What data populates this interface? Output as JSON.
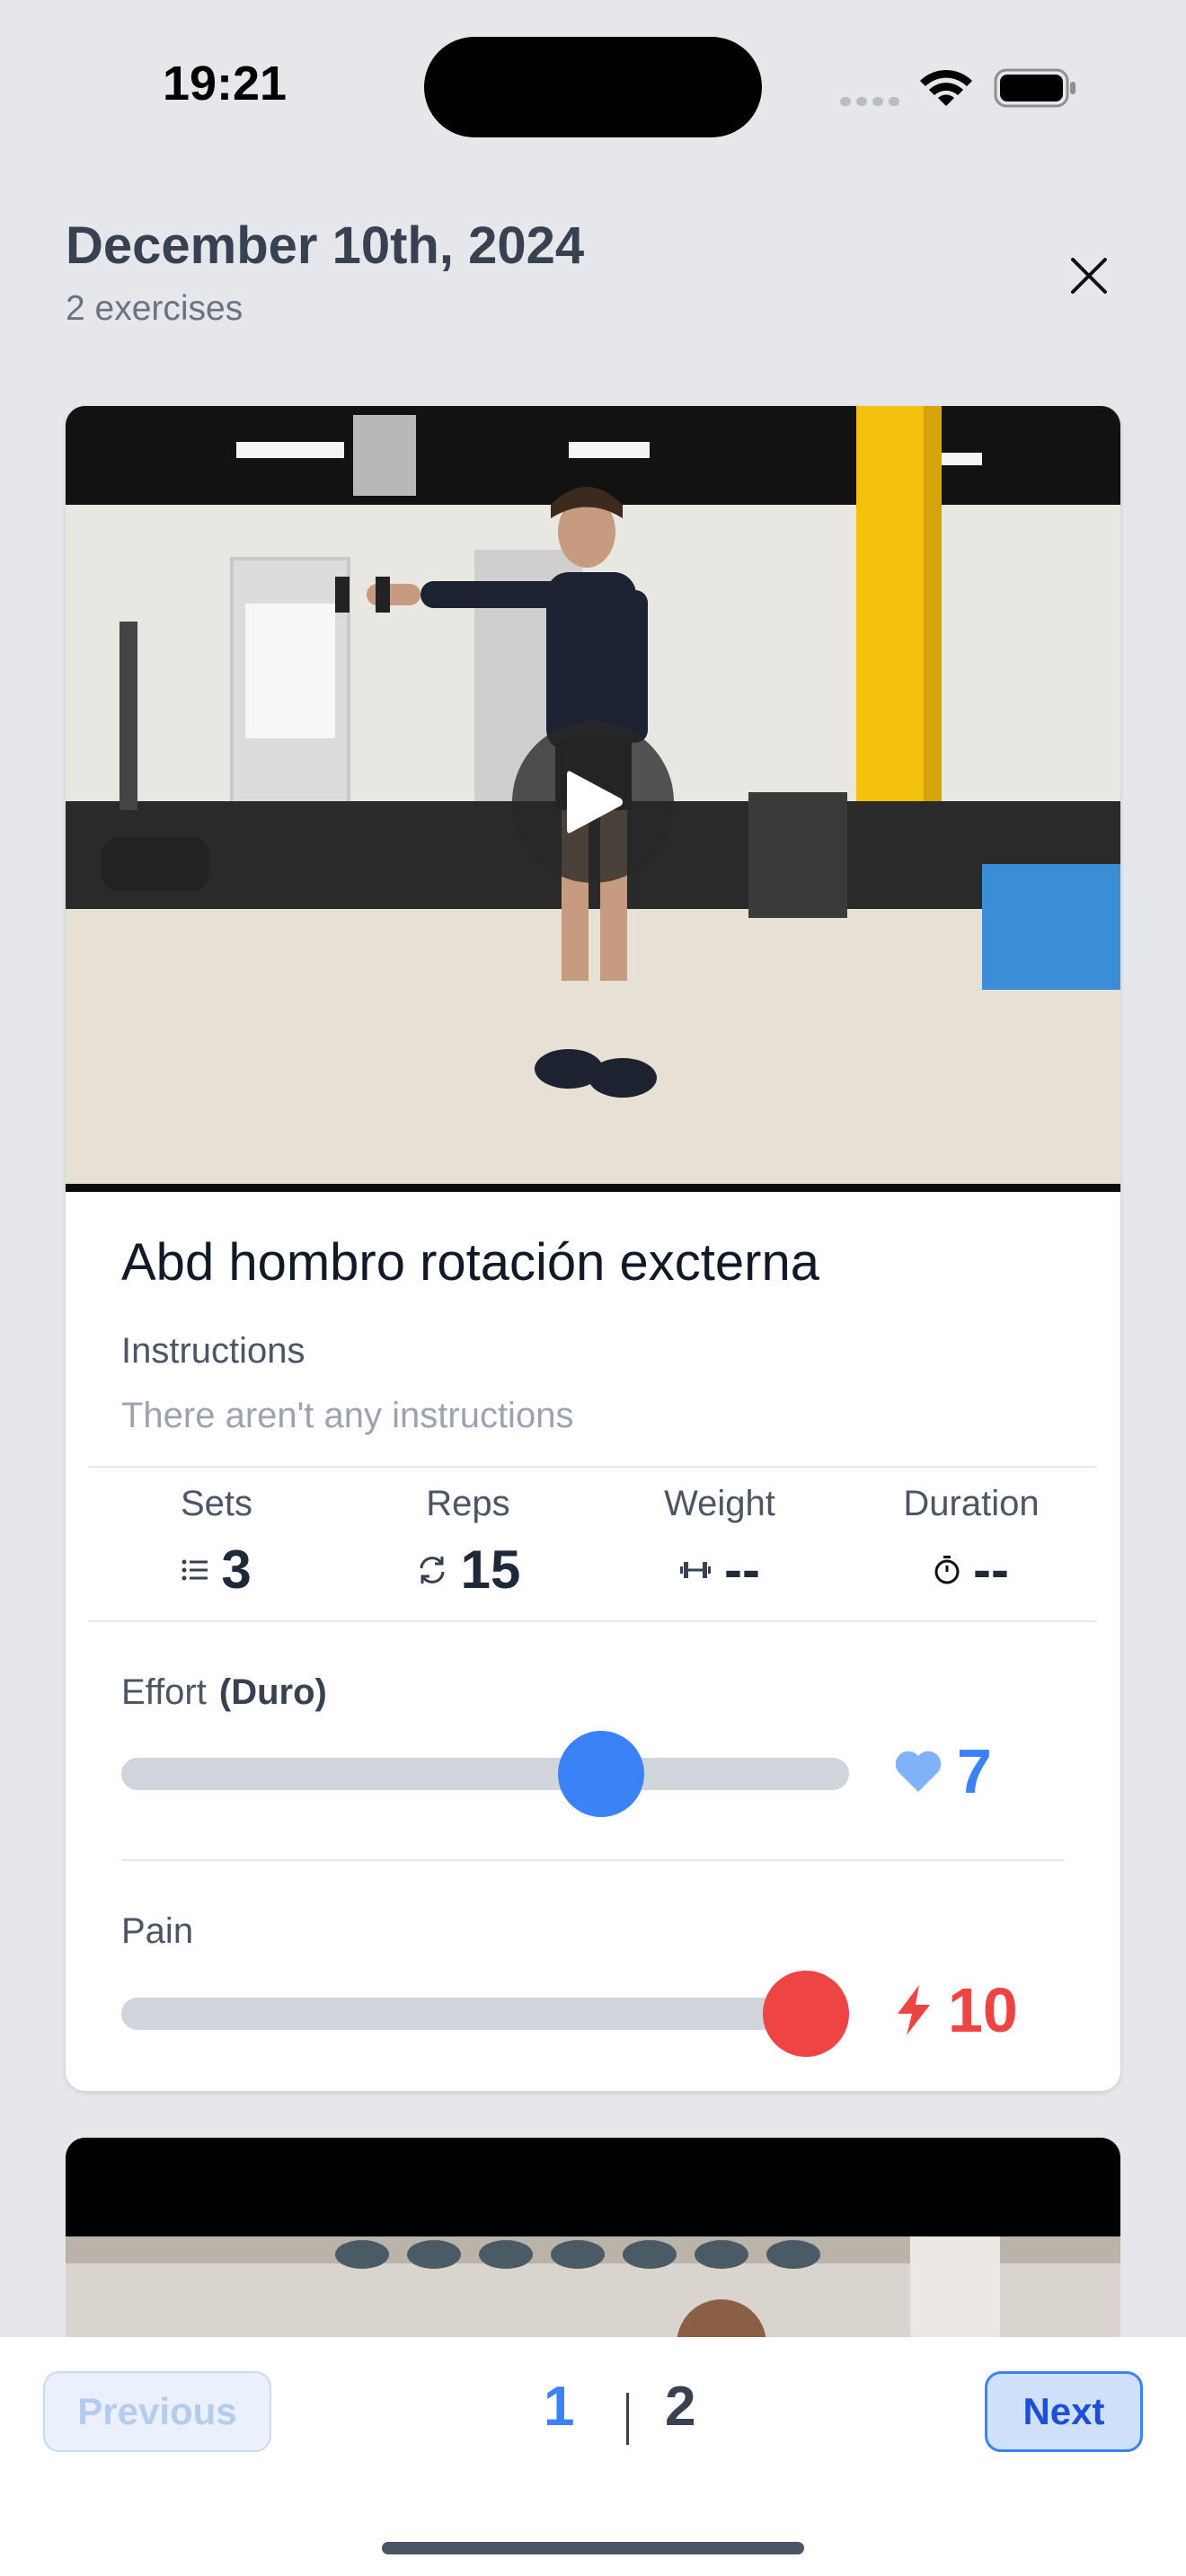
{
  "status_bar": {
    "time": "19:21"
  },
  "header": {
    "title": "December 10th, 2024",
    "subtitle": "2 exercises"
  },
  "exercise": {
    "title": "Abd hombro rotación excterna",
    "instructions_label": "Instructions",
    "instructions_text": "There aren't any instructions",
    "stats": {
      "sets": {
        "label": "Sets",
        "value": "3",
        "icon": "list-icon"
      },
      "reps": {
        "label": "Reps",
        "value": "15",
        "icon": "repeat-icon"
      },
      "weight": {
        "label": "Weight",
        "value": "--",
        "icon": "dumbbell-icon"
      },
      "duration": {
        "label": "Duration",
        "value": "--",
        "icon": "stopwatch-icon"
      }
    },
    "effort": {
      "label": "Effort",
      "level": "(Duro)",
      "value": "7",
      "slider_fraction": 0.7,
      "icon": "heart-icon",
      "color": "#3b82f6"
    },
    "pain": {
      "label": "Pain",
      "value": "10",
      "slider_fraction": 1.0,
      "icon": "lightning-icon",
      "color": "#ef4444"
    }
  },
  "pagination": {
    "previous_label": "Previous",
    "next_label": "Next",
    "current_page": "1",
    "total_pages": "2"
  }
}
